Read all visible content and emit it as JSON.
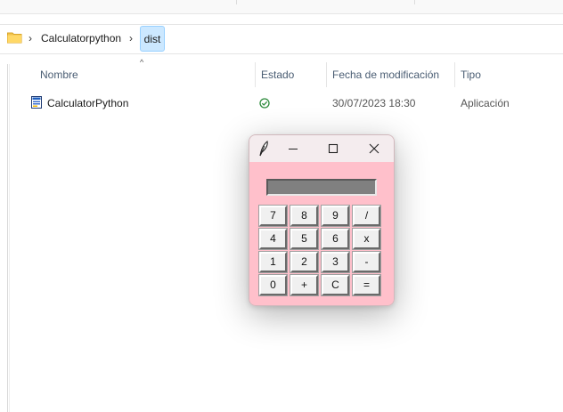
{
  "breadcrumb": {
    "items": [
      "Calculatorpython",
      "dist"
    ],
    "separator": "›"
  },
  "columns": {
    "name": "Nombre",
    "status": "Estado",
    "modified": "Fecha de modificación",
    "type": "Tipo"
  },
  "files": [
    {
      "name": "CalculatorPython",
      "status_icon": "synced-check-icon",
      "modified": "30/07/2023 18:30",
      "type": "Aplicación"
    }
  ],
  "calculator": {
    "display_value": "",
    "keys": [
      [
        "7",
        "8",
        "9",
        "/"
      ],
      [
        "4",
        "5",
        "6",
        "x"
      ],
      [
        "1",
        "2",
        "3",
        "-"
      ],
      [
        "0",
        "+",
        "C",
        "="
      ]
    ],
    "background_color": "#ffc0cb",
    "display_color": "#808080"
  },
  "icons": {
    "folder": "folder-icon",
    "app": "feather-icon",
    "minimize": "minimize-icon",
    "maximize": "maximize-icon",
    "close": "close-icon"
  }
}
